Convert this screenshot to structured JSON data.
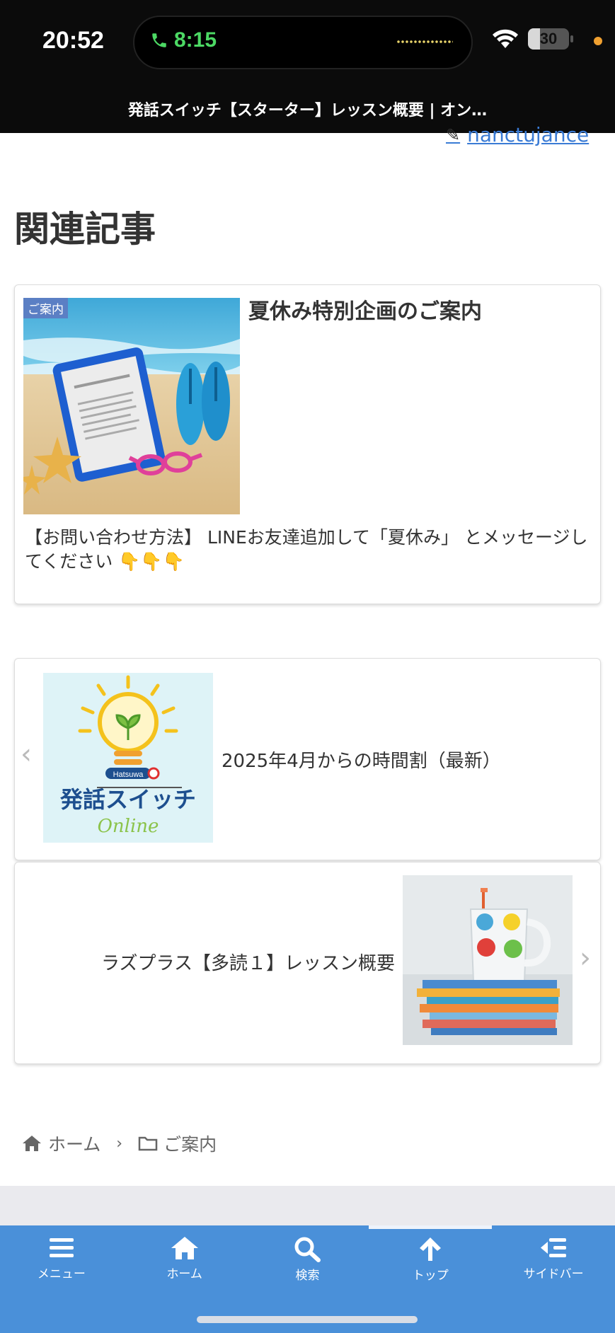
{
  "status_bar": {
    "time": "20:52",
    "call_time": "8:15",
    "battery": "30",
    "battery_level": 0.3
  },
  "browser": {
    "page_title": "発話スイッチ【スターター】レッスン概要 | オン…"
  },
  "author": {
    "name": "nanctujance"
  },
  "related": {
    "heading": "関連記事",
    "card": {
      "category": "ご案内",
      "title": "夏休み特別企画のご案内",
      "snippet": "【お問い合わせ方法】 LINEお友達追加して「夏休み」 とメッセージしてください 👇👇👇"
    }
  },
  "post_nav": {
    "prev": {
      "title": "2025年4月からの時間割（最新）",
      "logo_top": "Hatsuwa",
      "logo_main": "発話スイッチ",
      "logo_sub": "Online"
    },
    "next": {
      "title": "ラズプラス【多読１】レッスン概要"
    }
  },
  "breadcrumb": {
    "home": "ホーム",
    "category": "ご案内"
  },
  "bottom_nav": {
    "menu": "メニュー",
    "home": "ホーム",
    "search": "検索",
    "top": "トップ",
    "sidebar": "サイドバー"
  },
  "colors": {
    "accent": "#4a90d9",
    "link": "#3a7bd5",
    "category_badge": "#5b7fc4"
  }
}
